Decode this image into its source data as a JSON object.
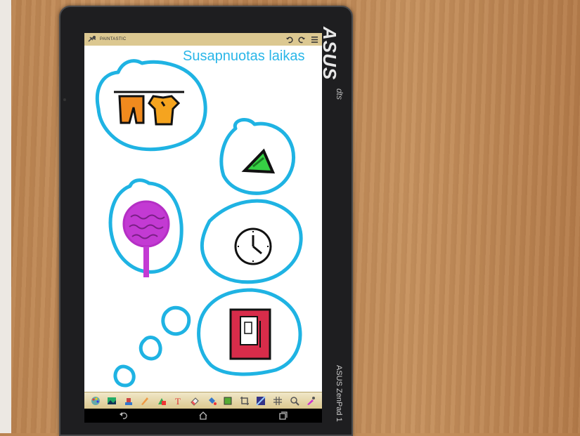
{
  "app": {
    "name": "PAINTASTIC"
  },
  "canvas": {
    "title": "Susapnuotas laikas"
  },
  "device": {
    "brand_logo": "ASUS",
    "side_label": "ASUS ZenPad 1",
    "badge": "dts"
  },
  "toolbar": {
    "tools": [
      "palette-icon",
      "image-icon",
      "brush-size-icon",
      "pencil-icon",
      "shapes-icon",
      "text-icon",
      "eraser-icon",
      "fill-bucket-icon",
      "layer-icon",
      "crop-icon",
      "background-icon",
      "grid-icon",
      "zoom-icon",
      "eyedropper-icon"
    ]
  },
  "colors": {
    "cloud_outline": "#1fb3e3",
    "appbar": "#dcc891",
    "title": "#29b6e8"
  }
}
